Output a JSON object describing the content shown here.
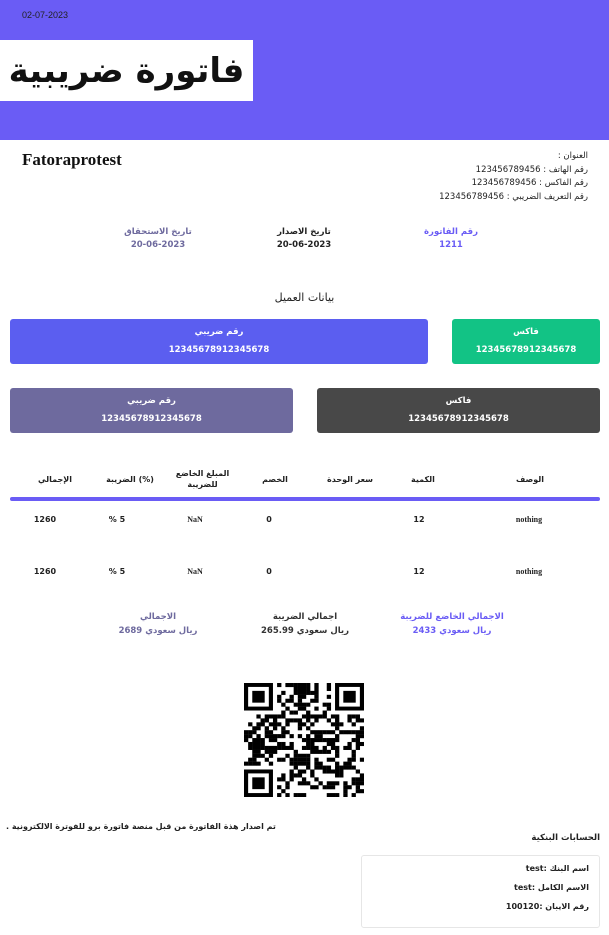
{
  "header": {
    "date": "02-07-2023",
    "title": "فاتورة ضريبية",
    "bg_color": "#6a5cf5"
  },
  "company": {
    "name": "Fatoraprotest",
    "address_label": "العنوان :",
    "phone_line": "رقم الهاتف : 123456789456",
    "fax_line": "رقم الفاكس : 123456789456",
    "tax_line": "رقم التعريف الضريبي : 123456789456"
  },
  "invoice_meta": {
    "due_date_label": "تاريخ الاستحقاق",
    "due_date": "20-06-2023",
    "issue_date_label": "تاريخ الاصدار",
    "issue_date": "20-06-2023",
    "invoice_no_label": "رقم الفاتورة",
    "invoice_no": "1211"
  },
  "customer": {
    "section_title": "بيانات العميل",
    "cards": [
      {
        "label": "رقم ضريبي",
        "value": "12345678912345678",
        "color": "#5b5ef0"
      },
      {
        "label": "فاكس",
        "value": "12345678912345678",
        "color": "#12c385"
      },
      {
        "label": "رقم ضريبي",
        "value": "12345678912345678",
        "color": "#6e6a9e"
      },
      {
        "label": "فاكس",
        "value": "12345678912345678",
        "color": "#484848"
      }
    ]
  },
  "table": {
    "headers": {
      "total": "الإجمالي",
      "tax": "الضريبة (%)",
      "taxable_line1": "المبلغ الخاضع",
      "taxable_line2": "للضريبة",
      "discount": "الخصم",
      "unit_price": "سعر الوحدة",
      "qty": "الكمية",
      "desc": "الوصف"
    },
    "rows": [
      {
        "total": "1260",
        "tax": "5 %",
        "taxable": "NaN",
        "discount": "0",
        "unit_price": "",
        "qty": "12",
        "desc": "nothing"
      },
      {
        "total": "1260",
        "tax": "5 %",
        "taxable": "NaN",
        "discount": "0",
        "unit_price": "",
        "qty": "12",
        "desc": "nothing"
      }
    ]
  },
  "totals": {
    "grand_label": "الاجمالي",
    "grand_value": "2689 ريال سعودي",
    "tax_label": "اجمالي الضريبة",
    "tax_value": "265.99 ريال سعودي",
    "taxable_label": "الاجمالي الخاضع للضريبة",
    "taxable_value": "2433 ريال سعودي"
  },
  "qr": {
    "icon": "qr-code-icon"
  },
  "footer": {
    "issued_note": "تم اصدار هذة الفاتورة من قبل منصة فاتورة برو للفوترة الالكترونية .",
    "bank_title": "الحسابات البنكية",
    "bank_name_line": "اسم البنك :test",
    "full_name_line": "الاسم الكامل :test",
    "iban_line": "رقم الايبان :100120"
  }
}
